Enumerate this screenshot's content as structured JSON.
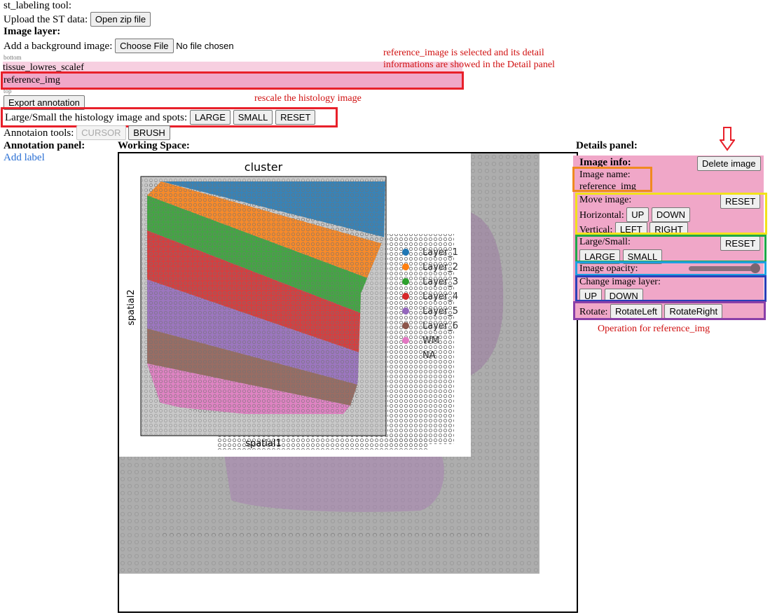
{
  "app_title": "st_labeling tool:",
  "upload": {
    "label": "Upload the ST data:",
    "button": "Open zip file"
  },
  "image_layer": {
    "heading": "Image layer:",
    "bg_label": "Add a background image:",
    "choose_button": "Choose File",
    "no_file": "No file chosen",
    "bottom_tag": "bottom",
    "top_tag": "top",
    "layers": [
      "tissue_lowres_scalef",
      "reference_img"
    ]
  },
  "export_button": "Export annotation",
  "scale_row": {
    "label": "Large/Small the histology image and spots:",
    "large": "LARGE",
    "small": "SMALL",
    "reset": "RESET"
  },
  "annot_tools": {
    "label": "Annotaion tools:",
    "cursor": "CURSOR",
    "brush": "BRUSH"
  },
  "annotation_panel": {
    "heading": "Annotation panel:",
    "add_label": "Add label"
  },
  "working_space": {
    "heading": "Working Space:"
  },
  "notes": {
    "selected_line1": "reference_image is selected and its detail",
    "selected_line2": "informations are showed in the Detail panel",
    "rescale": "rescale the histology image",
    "operation": "Operation for reference_img"
  },
  "details": {
    "heading": "Details panel:",
    "image_info": "Image info:",
    "delete_button": "Delete image",
    "image_name_label": "Image name:",
    "image_name_value": "reference_img",
    "move_label": "Move image:",
    "move_reset": "RESET",
    "horizontal_label": "Horizontal:",
    "up": "UP",
    "down": "DOWN",
    "vertical_label": "Vertical:",
    "left": "LEFT",
    "right": "RIGHT",
    "ls_label": "Large/Small:",
    "ls_reset": "RESET",
    "large": "LARGE",
    "small": "SMALL",
    "opacity_label": "Image opacity:",
    "opacity_value": 1.0,
    "change_layer_label": "Change image layer:",
    "layer_up": "UP",
    "layer_down": "DOWN",
    "rotate_label": "Rotate:",
    "rotate_left": "RotateLeft",
    "rotate_right": "RotateRight"
  },
  "colors": {
    "annotation_red": "#e8202a",
    "panel_pink": "#f0a7c8",
    "layer_pink_light": "#f7cfe0",
    "orange": "#f08a1f",
    "yellow": "#f2e21a",
    "green": "#1fa84a",
    "blue_light": "#1ea0e0",
    "blue_dark": "#2a3fb8",
    "purple": "#8a3fa8"
  },
  "chart_data": {
    "type": "scatter",
    "title": "cluster",
    "xlabel": "spatial1",
    "ylabel": "spatial2",
    "legend": [
      "Layer_1",
      "Layer_2",
      "Layer_3",
      "Layer_4",
      "Layer_5",
      "Layer_6",
      "WM",
      "NA"
    ],
    "legend_colors": [
      "#1f77b4",
      "#ff7f0e",
      "#2ca02c",
      "#d62728",
      "#9467bd",
      "#8c564b",
      "#e377c2",
      "#7f7f7f"
    ],
    "legend_placement": "right"
  }
}
